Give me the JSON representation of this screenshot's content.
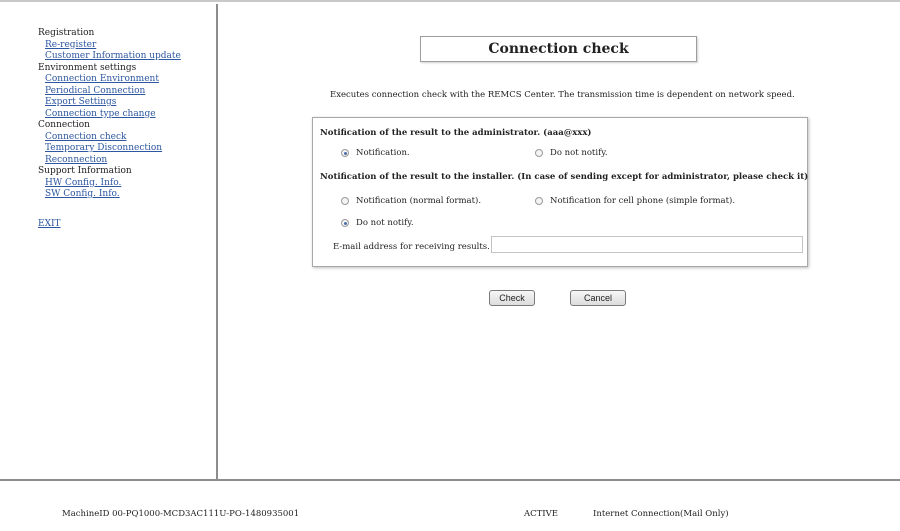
{
  "sidebar": {
    "groups": [
      {
        "label": "Registration",
        "items": [
          "Re-register",
          "Customer Information update"
        ]
      },
      {
        "label": "Environment settings",
        "items": [
          "Connection Environment",
          "Periodical Connection",
          "Export Settings",
          "Connection type change"
        ]
      },
      {
        "label": "Connection",
        "items": [
          "Connection check",
          "Temporary Disconnection",
          "Reconnection"
        ]
      },
      {
        "label": "Support Information",
        "items": [
          "HW Config. Info.",
          "SW Config. Info."
        ]
      }
    ],
    "exit": "EXIT"
  },
  "main": {
    "title": "Connection check",
    "description": "Executes connection check with the REMCS Center. The transmission time is dependent on network speed.",
    "admin": {
      "heading": "Notification of the result to the administrator. (aaa@xxx)",
      "opt_notify": "Notification.",
      "opt_no_notify": "Do not notify.",
      "selected": "notify"
    },
    "installer": {
      "heading": "Notification of the result to the installer. (In case of sending except for administrator, please check it)",
      "opt_normal": "Notification (normal format).",
      "opt_cell": "Notification for cell phone (simple format).",
      "opt_no_notify": "Do not notify.",
      "selected": "no_notify"
    },
    "email_label": "E-mail address for receiving results.",
    "email_value": "",
    "check_label": "Check",
    "cancel_label": "Cancel"
  },
  "footer": {
    "machine_id": "MachineID  00-PQ1000-MCD3AC111U-PO-1480935001",
    "status": "ACTIVE",
    "connection": "Internet Connection(Mail Only)"
  },
  "colors": {
    "link": "#2d57a0",
    "border": "#8d8d8d"
  }
}
